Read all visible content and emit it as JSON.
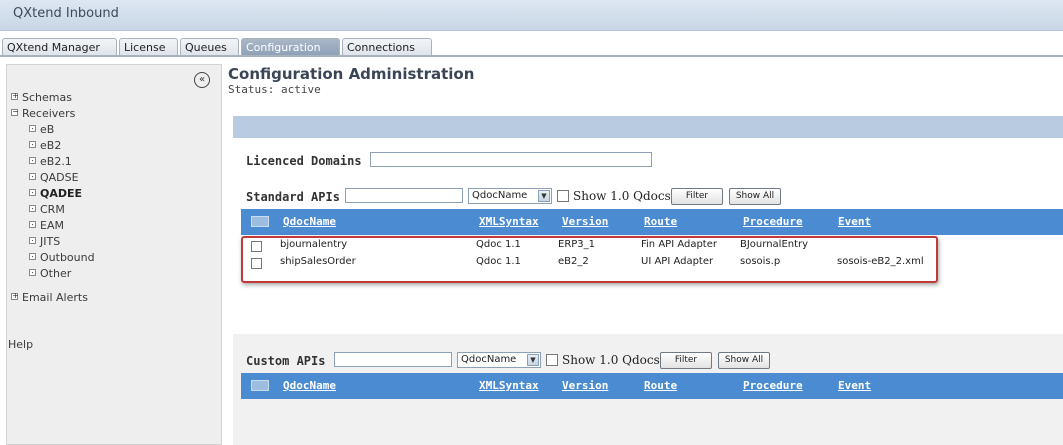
{
  "window": {
    "title": "QXtend Inbound"
  },
  "tabs": [
    {
      "label": "QXtend Manager",
      "active": false
    },
    {
      "label": "License",
      "active": false
    },
    {
      "label": "Queues",
      "active": false
    },
    {
      "label": "Configuration",
      "active": true
    },
    {
      "label": "Connections",
      "active": false
    }
  ],
  "sidebar": {
    "collapse_icon": "double-chevron-left-icon",
    "items": [
      {
        "label": "Schemas",
        "expander": "+"
      },
      {
        "label": "Receivers",
        "expander": "−"
      },
      {
        "label": "eB"
      },
      {
        "label": "eB2"
      },
      {
        "label": "eB2.1"
      },
      {
        "label": "QADSE"
      },
      {
        "label": "QADEE",
        "selected": true
      },
      {
        "label": "CRM"
      },
      {
        "label": "EAM"
      },
      {
        "label": "JITS"
      },
      {
        "label": "Outbound"
      },
      {
        "label": "Other"
      },
      {
        "label": "Email Alerts",
        "expander": "+"
      }
    ],
    "help_label": "Help"
  },
  "main": {
    "title": "Configuration Administration",
    "status": "Status: active",
    "licensed_domains_label": "Licenced Domains",
    "licensed_domains_value": ""
  },
  "standard_apis": {
    "label": "Standard APIs",
    "search_value": "",
    "filter_field": "QdocName",
    "show_label": "Show 1.0 Qdocs",
    "filter_button": "Filter",
    "show_all_button": "Show All",
    "columns": [
      "QdocName",
      "XMLSyntax",
      "Version",
      "Route",
      "Procedure",
      "Event"
    ],
    "rows": [
      {
        "qdoc": "bjournalentry",
        "syntax": "Qdoc 1.1",
        "version": "ERP3_1",
        "route": "Fin API Adapter",
        "procedure": "BJournalEntry",
        "event": ""
      },
      {
        "qdoc": "shipSalesOrder",
        "syntax": "Qdoc 1.1",
        "version": "eB2_2",
        "route": "UI API Adapter",
        "procedure": "sosois.p",
        "event": "sosois-eB2_2.xml"
      }
    ]
  },
  "custom_apis": {
    "label": "Custom APIs",
    "search_value": "",
    "filter_field": "QdocName",
    "show_label": "Show 1.0 Qdocs",
    "filter_button": "Filter",
    "show_all_button": "Show All",
    "columns": [
      "QdocName",
      "XMLSyntax",
      "Version",
      "Route",
      "Procedure",
      "Event"
    ]
  },
  "colors": {
    "header_blue": "#4a8bd2",
    "highlight_red": "#c03a3a",
    "bar_blue": "#b8cbe0"
  }
}
